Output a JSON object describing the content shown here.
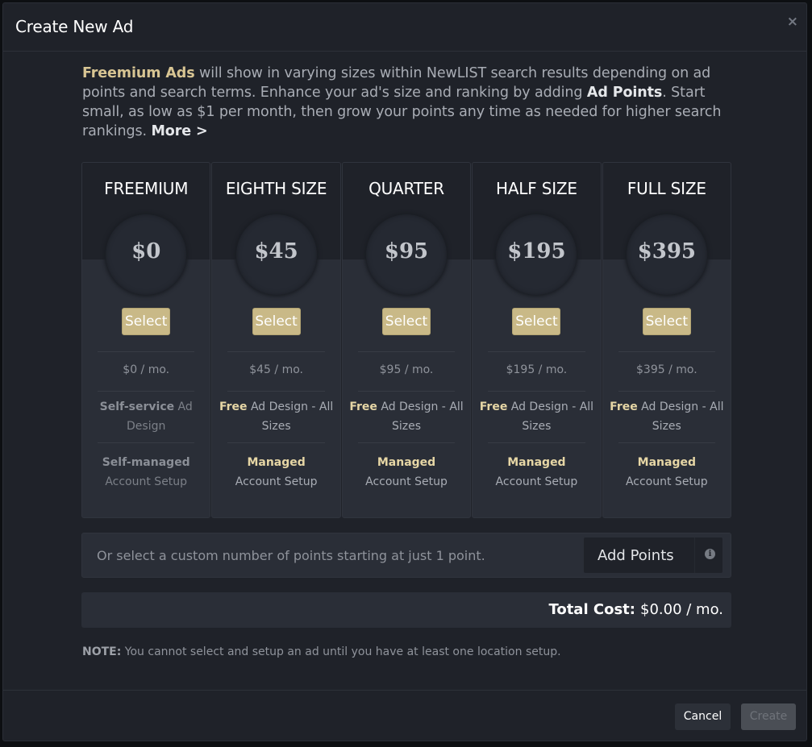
{
  "dialog": {
    "title": "Create New Ad",
    "close_glyph": "×"
  },
  "intro": {
    "p1_bold": "Freemium Ads",
    "p1_rest": " will show in varying sizes within NewLIST search results depending on ad points and search terms. Enhance your ad's size and ranking by adding ",
    "p2_bold": "Ad Points",
    "p2_rest": ". Start small, as low as $1 per month, then grow your points any time as needed for higher search rankings. ",
    "more_link": "More >"
  },
  "plans": [
    {
      "name": "FREEMIUM",
      "price": "$0",
      "select_label": "Select",
      "per_month": "$0 / mo.",
      "feature1_bold": "Self-service",
      "feature1_rest": " Ad Design",
      "feature2_bold": "Self-managed",
      "feature2_rest": "Account Setup"
    },
    {
      "name": "EIGHTH SIZE",
      "price": "$45",
      "select_label": "Select",
      "per_month": "$45 / mo.",
      "feature1_bold": "Free",
      "feature1_rest": " Ad Design - All Sizes",
      "feature2_bold": "Managed",
      "feature2_rest": "Account Setup"
    },
    {
      "name": "QUARTER",
      "price": "$95",
      "select_label": "Select",
      "per_month": "$95 / mo.",
      "feature1_bold": "Free",
      "feature1_rest": " Ad Design - All Sizes",
      "feature2_bold": "Managed",
      "feature2_rest": "Account Setup"
    },
    {
      "name": "HALF SIZE",
      "price": "$195",
      "select_label": "Select",
      "per_month": "$195 / mo.",
      "feature1_bold": "Free",
      "feature1_rest": " Ad Design - All Sizes",
      "feature2_bold": "Managed",
      "feature2_rest": "Account Setup"
    },
    {
      "name": "FULL SIZE",
      "price": "$395",
      "select_label": "Select",
      "per_month": "$395 / mo.",
      "feature1_bold": "Free",
      "feature1_rest": " Ad Design - All Sizes",
      "feature2_bold": "Managed",
      "feature2_rest": "Account Setup"
    }
  ],
  "custom_points": {
    "text": "Or select a custom number of points starting at just 1 point.",
    "add_points_label": "Add Points",
    "info_glyph": "i"
  },
  "total": {
    "label": "Total Cost:",
    "value": "$0.00 / mo."
  },
  "note": {
    "label": "NOTE:",
    "text": " You cannot select and setup an ad until you have at least one location setup."
  },
  "footer": {
    "cancel_label": "Cancel",
    "create_label": "Create"
  },
  "colors": {
    "gold_accent": "#c9b987",
    "gold_text": "#d8c593",
    "panel_bg": "#2a2e37",
    "modal_bg": "#1f2229"
  }
}
